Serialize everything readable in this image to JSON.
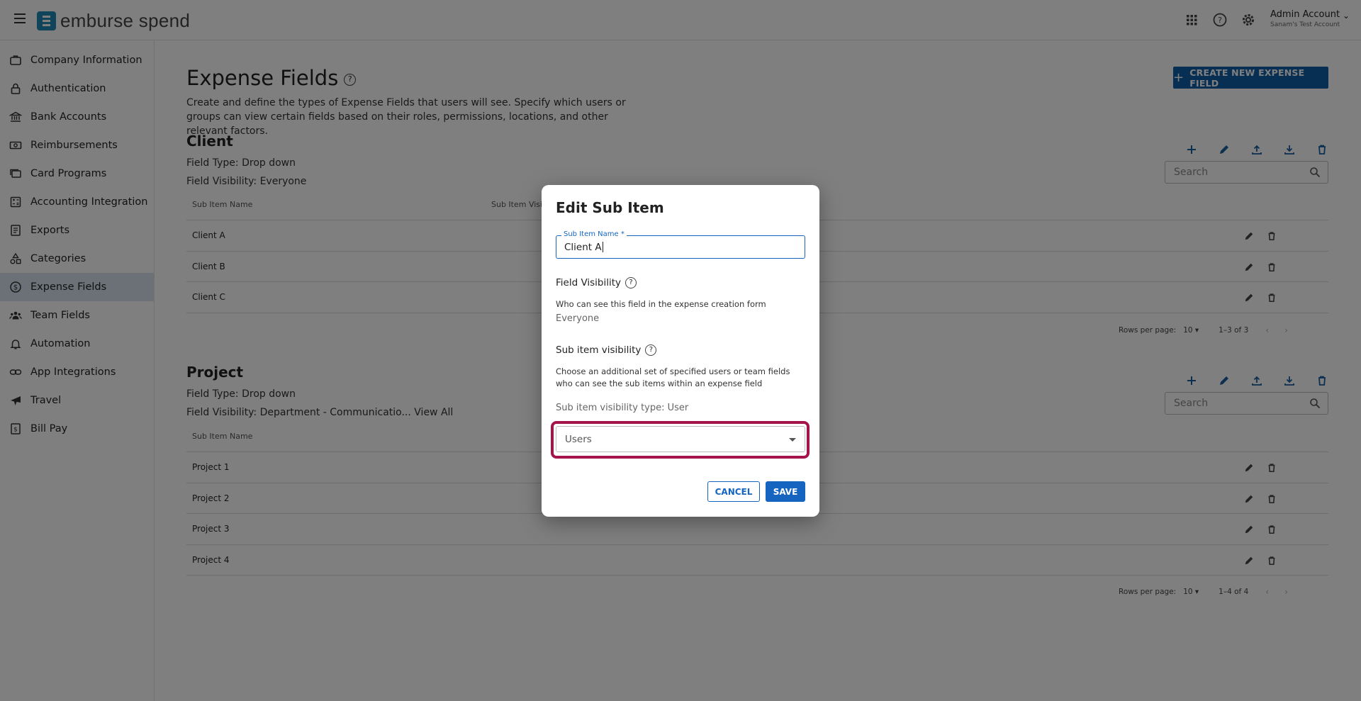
{
  "header": {
    "logo_text": "emburse spend",
    "account_name": "Admin Account",
    "account_sub": "Sanam's Test Account"
  },
  "sidebar": {
    "items": [
      {
        "label": "Company Information",
        "icon": "briefcase-icon"
      },
      {
        "label": "Authentication",
        "icon": "lock-icon"
      },
      {
        "label": "Bank Accounts",
        "icon": "bank-icon"
      },
      {
        "label": "Reimbursements",
        "icon": "money-icon"
      },
      {
        "label": "Card Programs",
        "icon": "cards-icon"
      },
      {
        "label": "Accounting Integration",
        "icon": "calculator-icon"
      },
      {
        "label": "Exports",
        "icon": "document-icon"
      },
      {
        "label": "Categories",
        "icon": "shapes-icon"
      },
      {
        "label": "Expense Fields",
        "icon": "dollar-circle-icon",
        "active": true
      },
      {
        "label": "Team Fields",
        "icon": "people-icon"
      },
      {
        "label": "Automation",
        "icon": "bell-icon"
      },
      {
        "label": "App Integrations",
        "icon": "link-icon"
      },
      {
        "label": "Travel",
        "icon": "airplane-icon"
      },
      {
        "label": "Bill Pay",
        "icon": "invoice-icon"
      }
    ]
  },
  "main": {
    "title": "Expense Fields",
    "description": "Create and define the types of Expense Fields that users will see. Specify which users or groups can view certain fields based on their roles, permissions, locations, and other relevant factors.",
    "create_button": "CREATE NEW EXPENSE FIELD",
    "search_placeholder": "Search",
    "sections": [
      {
        "title": "Client",
        "field_type": "Field Type: Drop down",
        "visibility": "Field Visibility: Everyone",
        "col1": "Sub Item Name",
        "col2": "Sub Item Visib",
        "rows": [
          "Client A",
          "Client B",
          "Client C"
        ],
        "rows_per_page_label": "Rows per page:",
        "rows_per_page": "10",
        "range": "1–3 of 3"
      },
      {
        "title": "Project",
        "field_type": "Field Type: Drop down",
        "visibility": "Field Visibility: Department - Communicatio... View All",
        "col1": "Sub Item Name",
        "rows": [
          "Project 1",
          "Project 2",
          "Project 3",
          "Project 4"
        ],
        "rows_per_page_label": "Rows per page:",
        "rows_per_page": "10",
        "range": "1–4 of 4"
      }
    ]
  },
  "dialog": {
    "title": "Edit Sub Item",
    "name_label": "Sub Item Name *",
    "name_value": "Client A",
    "field_visibility_heading": "Field Visibility",
    "field_visibility_desc": "Who can see this field in the expense creation form",
    "field_visibility_value": "Everyone",
    "sub_visibility_heading": "Sub item visibility",
    "sub_visibility_desc": "Choose an additional set of specified users or team fields who can see the sub items within an expense field",
    "sub_visibility_type": "Sub item visibility type: User",
    "select_value": "Users",
    "cancel": "CANCEL",
    "save": "SAVE"
  },
  "colors": {
    "primary": "#1565c0",
    "create_button": "#0f5fa8",
    "highlight": "#a4144a",
    "active_nav": "#d6e3ee"
  }
}
